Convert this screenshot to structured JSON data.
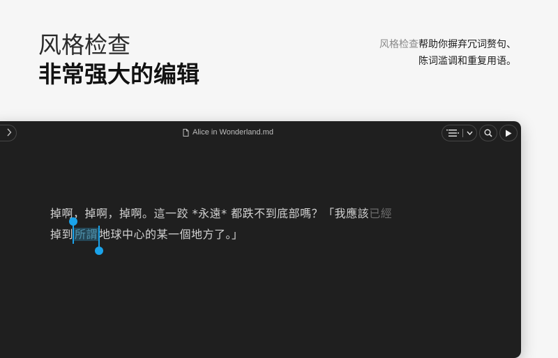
{
  "hero": {
    "title_line1": "风格检查",
    "title_line2": "非常强大的编辑",
    "desc_highlight": "风格检查",
    "desc_line1_rest": "帮助你摒弃冗词赘句、",
    "desc_line2": "陈词滥调和重复用语。"
  },
  "window": {
    "doc_title": "Alice in Wonderland.md",
    "icons": {
      "forward": "chevron-right-icon",
      "doc": "document-icon",
      "outline": "list-icon",
      "dropdown": "chevron-down-icon",
      "search": "search-icon",
      "play": "play-icon"
    }
  },
  "editor": {
    "line1": "掉啊，掉啊，掉啊。這一跤 *永遠* 都跌不到底部嗎？「我應該",
    "line1_faded": "已經",
    "line2_pre": "掉到",
    "line2_selected": "所謂",
    "line2_post": "地球中心的某一個地方了。」"
  },
  "colors": {
    "accent": "#1aa3ea",
    "selection_bg": "#244656",
    "editor_bg": "#1f1f1f",
    "page_bg": "#f6f6f6"
  }
}
